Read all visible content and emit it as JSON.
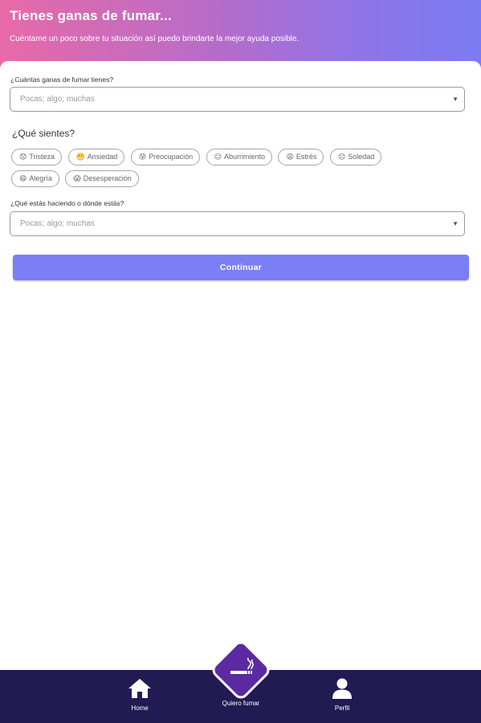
{
  "header": {
    "title": "Tienes ganas de fumar...",
    "subtitle": "Cuéntame un poco sobre tu situación así puedo brindarte la mejor ayuda posible."
  },
  "form": {
    "craving": {
      "label": "¿Cuántas ganas de fumar tienes?",
      "placeholder": "Pocas; algo; muchas"
    },
    "feelings_title": "¿Qué sientes?",
    "feelings": [
      {
        "emoji": "😟",
        "label": "Tristeza"
      },
      {
        "emoji": "😬",
        "label": "Ansiedad"
      },
      {
        "emoji": "😰",
        "label": "Preocupación"
      },
      {
        "emoji": "😑",
        "label": "Aburrimiento"
      },
      {
        "emoji": "😩",
        "label": "Estrés"
      },
      {
        "emoji": "😔",
        "label": "Soledad"
      },
      {
        "emoji": "😄",
        "label": "Alegría"
      },
      {
        "emoji": "😱",
        "label": "Desesperación"
      }
    ],
    "activity": {
      "label": "¿Qué estás haciendo o dónde estás?",
      "placeholder": "Pocas; algo; muchas"
    },
    "continue_label": "Continuar"
  },
  "nav": {
    "home_label": "Home",
    "center_label": "Quiero fumar",
    "profile_label": "Perfil"
  },
  "colors": {
    "header_gradient_start": "#e86aa8",
    "header_gradient_end": "#7b7cf3",
    "button": "#7b7ff5",
    "nav_bg": "#221a52",
    "center_button": "#5b2aa0"
  }
}
